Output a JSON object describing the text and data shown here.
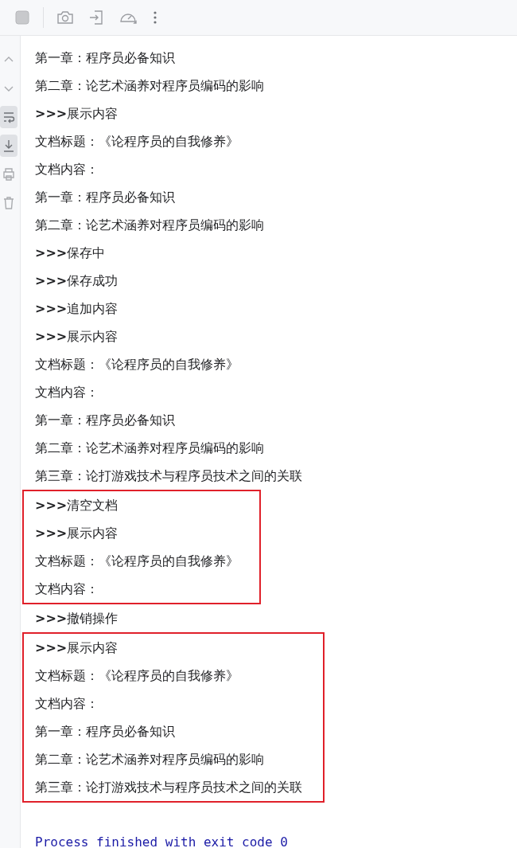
{
  "toolbar": [
    {
      "kind": "stop",
      "disabled": true
    },
    {
      "kind": "camera",
      "disabled": false
    },
    {
      "kind": "enter",
      "disabled": false
    },
    {
      "kind": "gauge",
      "disabled": false
    },
    {
      "kind": "more",
      "disabled": false
    }
  ],
  "gutter": [
    {
      "kind": "up",
      "selected": false
    },
    {
      "kind": "down",
      "selected": false
    },
    {
      "kind": "wrap",
      "selected": true
    },
    {
      "kind": "scroll-end",
      "selected": true
    },
    {
      "kind": "print",
      "selected": false
    },
    {
      "kind": "trash",
      "selected": false
    }
  ],
  "output": [
    {
      "kind": "line",
      "text": "第一章：程序员必备知识"
    },
    {
      "kind": "line",
      "text": "第二章：论艺术涵养对程序员编码的影响"
    },
    {
      "kind": "line",
      "text": "**>>>**展示内容"
    },
    {
      "kind": "line",
      "text": "文档标题：《论程序员的自我修养》"
    },
    {
      "kind": "line",
      "text": "文档内容："
    },
    {
      "kind": "line",
      "text": "第一章：程序员必备知识"
    },
    {
      "kind": "line",
      "text": "第二章：论艺术涵养对程序员编码的影响"
    },
    {
      "kind": "line",
      "text": "**>>>**保存中"
    },
    {
      "kind": "line",
      "text": "**>>>**保存成功"
    },
    {
      "kind": "line",
      "text": "**>>>**追加内容"
    },
    {
      "kind": "line",
      "text": "**>>>**展示内容"
    },
    {
      "kind": "line",
      "text": "文档标题：《论程序员的自我修养》"
    },
    {
      "kind": "line",
      "text": "文档内容："
    },
    {
      "kind": "line",
      "text": "第一章：程序员必备知识"
    },
    {
      "kind": "line",
      "text": "第二章：论艺术涵养对程序员编码的影响"
    },
    {
      "kind": "line",
      "text": "第三章：论打游戏技术与程序员技术之间的关联"
    },
    {
      "kind": "highlight",
      "color": "#e0202a",
      "lines": [
        "**>>>**清空文档",
        "**>>>**展示内容",
        "文档标题：《论程序员的自我修养》",
        "文档内容："
      ]
    },
    {
      "kind": "line",
      "text": "**>>>**撤销操作"
    },
    {
      "kind": "highlight",
      "color": "#e0202a",
      "lines": [
        "**>>>**展示内容",
        "文档标题：《论程序员的自我修养》",
        "文档内容：",
        "第一章：程序员必备知识",
        "第二章：论艺术涵养对程序员编码的影响",
        "第三章：论打游戏技术与程序员技术之间的关联"
      ]
    }
  ],
  "exit_message": "Process finished with exit code 0"
}
